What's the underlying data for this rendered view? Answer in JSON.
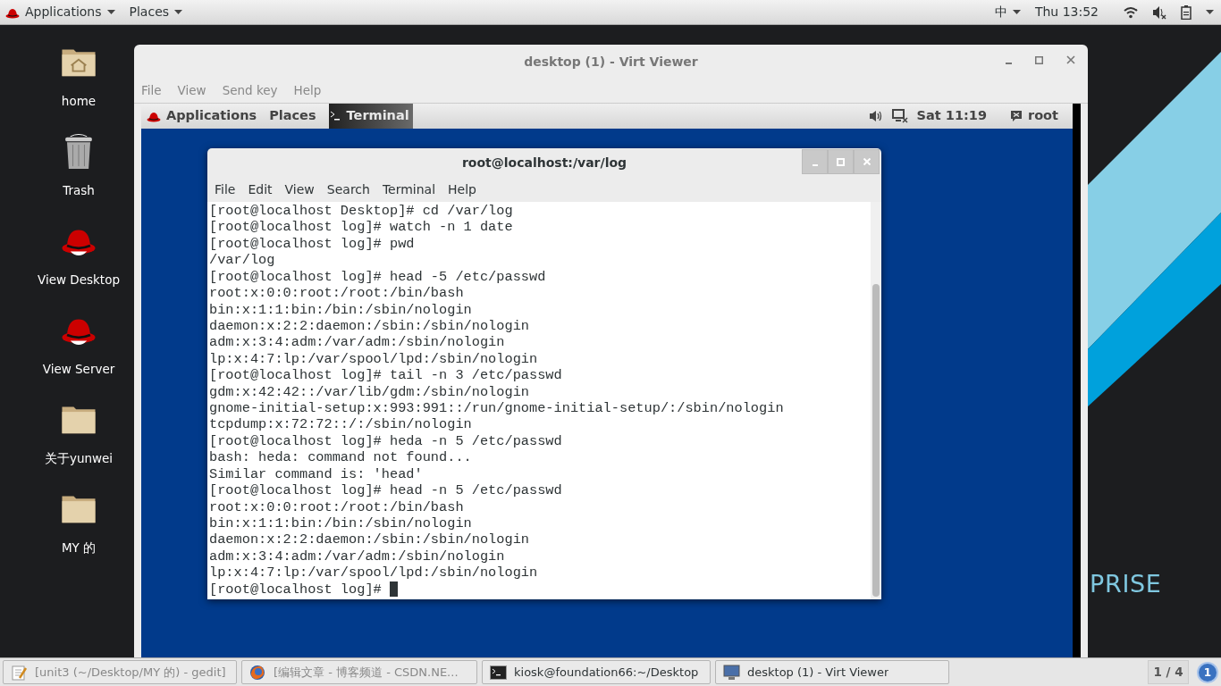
{
  "top_panel": {
    "menus": [
      {
        "label": "Applications"
      },
      {
        "label": "Places"
      }
    ],
    "input_method": "中",
    "clock": "Thu 13:52"
  },
  "desktop_icons": [
    {
      "label": "home",
      "kind": "home"
    },
    {
      "label": "Trash",
      "kind": "trash"
    },
    {
      "label": "View Desktop",
      "kind": "redhat"
    },
    {
      "label": "View Server",
      "kind": "redhat"
    },
    {
      "label": "关于yunwei",
      "kind": "folder"
    },
    {
      "label": "MY 的",
      "kind": "folder"
    }
  ],
  "wallpaper_text": "PRISE",
  "viewer_window": {
    "title": "desktop (1) - Virt Viewer",
    "menu": [
      "File",
      "View",
      "Send key",
      "Help"
    ],
    "guest": {
      "panel": {
        "menus": [
          "Applications",
          "Places"
        ],
        "task": "Terminal",
        "clock": "Sat 11:19",
        "user": "root"
      },
      "terminal": {
        "title": "root@localhost:/var/log",
        "menu": [
          "File",
          "Edit",
          "View",
          "Search",
          "Terminal",
          "Help"
        ],
        "lines": [
          "[root@localhost Desktop]# cd /var/log",
          "[root@localhost log]# watch -n 1 date",
          "[root@localhost log]# pwd",
          "/var/log",
          "[root@localhost log]# head -5 /etc/passwd",
          "root:x:0:0:root:/root:/bin/bash",
          "bin:x:1:1:bin:/bin:/sbin/nologin",
          "daemon:x:2:2:daemon:/sbin:/sbin/nologin",
          "adm:x:3:4:adm:/var/adm:/sbin/nologin",
          "lp:x:4:7:lp:/var/spool/lpd:/sbin/nologin",
          "[root@localhost log]# tail -n 3 /etc/passwd",
          "gdm:x:42:42::/var/lib/gdm:/sbin/nologin",
          "gnome-initial-setup:x:993:991::/run/gnome-initial-setup/:/sbin/nologin",
          "tcpdump:x:72:72::/:/sbin/nologin",
          "[root@localhost log]# heda -n 5 /etc/passwd",
          "bash: heda: command not found...",
          "Similar command is: 'head'",
          "[root@localhost log]# head -n 5 /etc/passwd",
          "root:x:0:0:root:/root:/bin/bash",
          "bin:x:1:1:bin:/bin:/sbin/nologin",
          "daemon:x:2:2:daemon:/sbin:/sbin/nologin",
          "adm:x:3:4:adm:/var/adm:/sbin/nologin",
          "lp:x:4:7:lp:/var/spool/lpd:/sbin/nologin",
          "[root@localhost log]# "
        ]
      }
    }
  },
  "taskbar": {
    "tasks": [
      {
        "label": "[unit3 (~/Desktop/MY 的) - gedit]",
        "kind": "editor"
      },
      {
        "label": "[编辑文章 - 博客频道 - CSDN.NE...",
        "kind": "browser"
      },
      {
        "label": "kiosk@foundation66:~/Desktop",
        "kind": "terminal"
      },
      {
        "label": "desktop (1) - Virt Viewer",
        "kind": "viewer"
      }
    ],
    "workspace": "1 / 4",
    "notification_count": "1"
  }
}
